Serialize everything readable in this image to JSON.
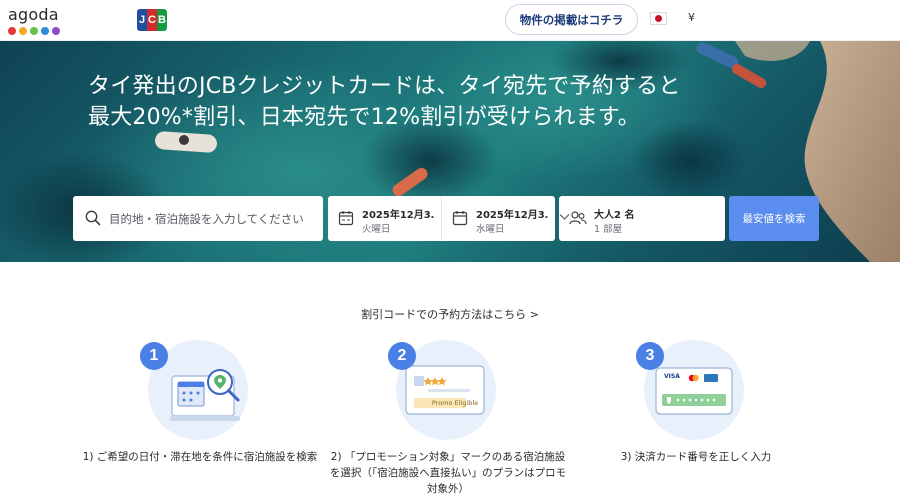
{
  "header": {
    "logo_text": "agoda",
    "logo_dot_colors": [
      "#e23a3a",
      "#f7a823",
      "#6bbf44",
      "#2d8ad8",
      "#8a4cc6"
    ],
    "partner_logo": "JCB",
    "list_property_label": "物件の掲載はコチラ",
    "language_flag_icon": "japan-flag-icon",
    "currency_label": "¥"
  },
  "hero": {
    "title": "タイ発出のJCBクレジットカードは、タイ宛先で予約すると最大20%*割引、日本宛先で12%割引が受けられます。"
  },
  "search": {
    "destination_placeholder": "目的地・宿泊施設を入力してください",
    "checkin_date": "2025年12月3…",
    "checkin_day": "火曜日",
    "checkout_date": "2025年12月3…",
    "checkout_day": "水曜日",
    "guests": "大人2 名",
    "rooms": "1 部屋",
    "search_button": "最安値を検索"
  },
  "howto": {
    "link_label": "割引コードでの予約方法はこちら >",
    "steps": [
      {
        "number": "1",
        "caption": "1) ご希望の日付・滞在地を条件に宿泊施設を検索"
      },
      {
        "number": "2",
        "caption": "2) 「プロモーション対象」マークのある宿泊施設を選択（「宿泊施設へ直接払い」のプランはプロモ対象外）",
        "badge": "Promo Eligible"
      },
      {
        "number": "3",
        "caption": "3) 決済カード番号を正しく入力",
        "card_brands": [
          "VISA"
        ]
      }
    ]
  },
  "colors": {
    "accent": "#5a8dee",
    "step_number": "#4a7fe6",
    "step_circle": "#e8f0fb",
    "list_button_text": "#1f3d7a"
  }
}
